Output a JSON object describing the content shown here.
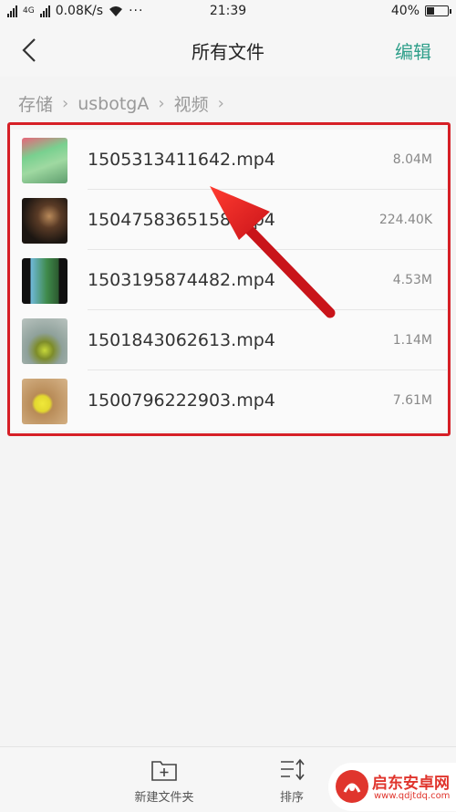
{
  "status_bar": {
    "network_type": "4G",
    "speed": "0.08K/s",
    "time": "21:39",
    "battery": "40%",
    "battery_level": 0.4
  },
  "header": {
    "title": "所有文件",
    "edit_label": "编辑"
  },
  "breadcrumb": [
    "存储",
    "usbotgA",
    "视频"
  ],
  "files": [
    {
      "name": "1505313411642.mp4",
      "size": "8.04M"
    },
    {
      "name": "1504758365158.mp4",
      "size": "224.40K"
    },
    {
      "name": "1503195874482.mp4",
      "size": "4.53M"
    },
    {
      "name": "1501843062613.mp4",
      "size": "1.14M"
    },
    {
      "name": "1500796222903.mp4",
      "size": "7.61M"
    }
  ],
  "toolbar": {
    "new_folder_label": "新建文件夹",
    "sort_label": "排序"
  },
  "watermark": {
    "brand": "启东安卓网",
    "url": "www.qdjtdq.com"
  },
  "colors": {
    "accent": "#2f9f8a",
    "highlight": "#d61f26"
  }
}
